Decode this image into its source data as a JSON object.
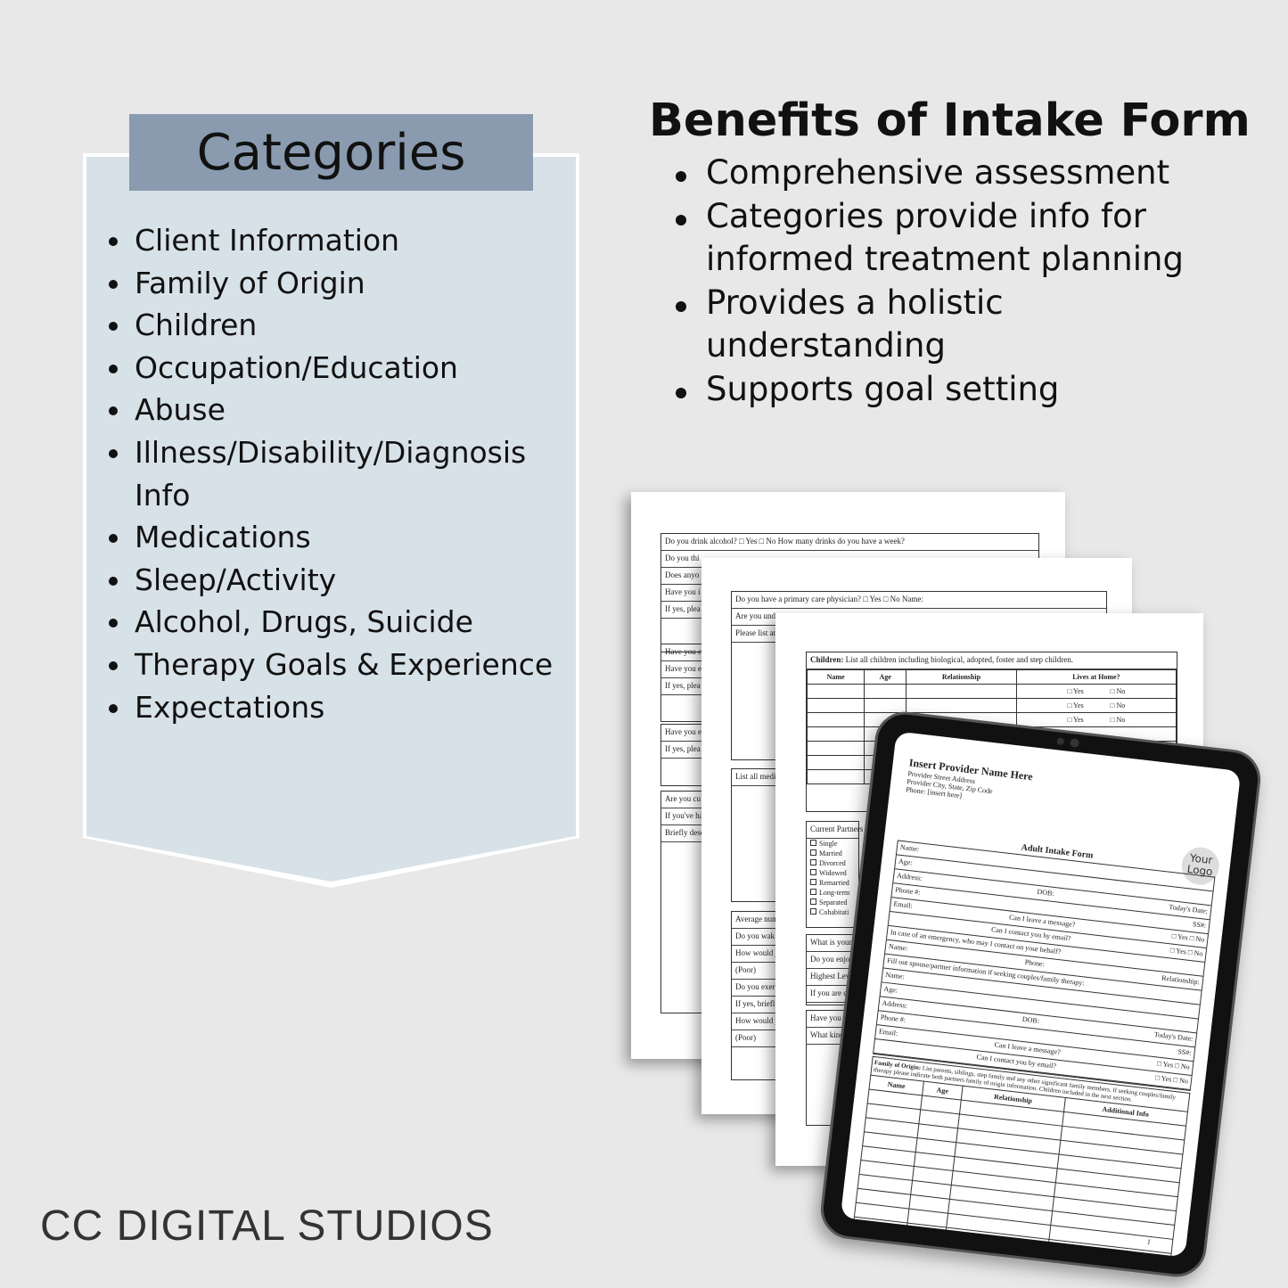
{
  "categories": {
    "title": "Categories",
    "items": [
      "Client Information",
      "Family of Origin",
      "Children",
      "Occupation/Education",
      "Abuse",
      "Illness/Disability/Diagnosis Info",
      "Medications",
      "Sleep/Activity",
      "Alcohol, Drugs, Suicide",
      "Therapy Goals & Experience",
      "Expectations"
    ]
  },
  "benefits": {
    "title": "Benefits of Intake Form",
    "items": [
      "Comprehensive assessment",
      "Categories provide info for informed treatment planning",
      "Provides a holistic understanding",
      "Supports goal setting"
    ]
  },
  "brand": "CC DIGITAL STUDIOS",
  "colors": {
    "background": "#e8e8e8",
    "panel": "#d7e1e8",
    "header": "#8a9bb0"
  },
  "page1": {
    "rows": [
      "Do you drink alcohol?   □ Yes   □ No   How many drinks do you have a week?",
      "Do you thi",
      "Does anyo",
      "Have you i",
      "If yes, plea"
    ],
    "rows2": [
      "Have you e",
      "Have you e",
      "If yes, plea"
    ],
    "rows3": [
      "Have you e",
      "If yes, plea"
    ],
    "rows4": [
      "Are you cu",
      "If you've ha",
      "Briefly desc"
    ]
  },
  "page2": {
    "rows": [
      "Do you have a primary care physician?   □ Yes   □ No   Name:",
      "Are you und",
      "Please list an"
    ],
    "meds": "List all medi",
    "sleep": [
      "Average num",
      "Do you wak",
      "How would y",
      "(Poor)",
      "Do you exer",
      "If yes, briefl",
      "How would y",
      "(Poor)"
    ]
  },
  "page3": {
    "children_title": "Children:",
    "children_desc": "List all children including biological, adopted, foster and step children.",
    "headers": [
      "Name",
      "Age",
      "Relationship",
      "Lives at Home?"
    ],
    "yes": "□ Yes",
    "no": "□ No",
    "partners": "Current Partners Na",
    "status": [
      "Single",
      "Married",
      "Divorced",
      "Widowed",
      "Remarried",
      "Long-term",
      "Separated",
      "Cohabitati"
    ],
    "occ": [
      "What is your",
      "Do you enjoy",
      "Highest Lev",
      "If you are c"
    ],
    "abuse": [
      "Have you",
      "What kind"
    ],
    "please": "Please"
  },
  "tablet": {
    "provider": "Insert Provider Name Here",
    "address": [
      "Provider Street Address",
      "Provider City, State, Zip Code",
      "Phone: [insert here]"
    ],
    "logo": "Your Logo",
    "form_title": "Adult Intake Form",
    "rows": [
      [
        "Name:",
        "",
        ""
      ],
      [
        "Age:",
        "",
        ""
      ],
      [
        "Address:",
        "DOB:",
        "Today's Date:"
      ],
      [
        "Phone #:",
        "",
        "SS#:"
      ],
      [
        "Email:",
        "Can I leave a message?",
        "□ Yes  □ No"
      ],
      [
        "",
        "Can I contact you by email?",
        "□ Yes  □ No"
      ],
      [
        "In case of an emergency, who may I contact on your behalf?",
        "",
        ""
      ],
      [
        "Name:",
        "Phone:",
        "Relationship:"
      ],
      [
        "Fill out spouse/partner information if seeking couples/family therapy:",
        "",
        ""
      ],
      [
        "Name:",
        "",
        ""
      ],
      [
        "Age:",
        "",
        ""
      ],
      [
        "Address:",
        "DOB:",
        "Today's Date:"
      ],
      [
        "Phone #:",
        "",
        "SS#:"
      ],
      [
        "Email:",
        "Can I leave a message?",
        "□ Yes  □ No"
      ],
      [
        "",
        "Can I contact you by email?",
        "□ Yes  □ No"
      ]
    ],
    "fo_title": "Family of Origin:",
    "fo_desc": "List parents, siblings, step family and any other significant family members. If seeking couples/family therapy please indicate both partners family of origin information. Children included in the next section.",
    "fo_headers": [
      "Name",
      "Age",
      "Relationship",
      "Additional Info"
    ],
    "page_number": "1"
  }
}
